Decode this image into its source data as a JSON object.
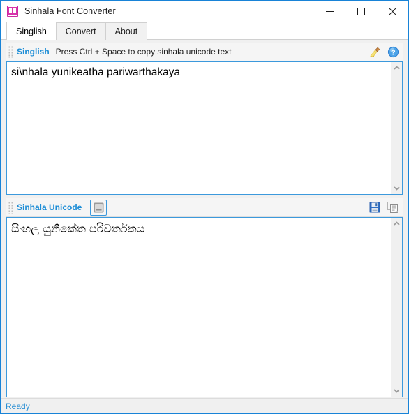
{
  "window": {
    "title": "Sinhala Font Converter",
    "icon": "app-icon",
    "controls": {
      "minimize": "minimize-icon",
      "maximize": "maximize-icon",
      "close": "close-icon"
    },
    "accent_color": "#1883d7"
  },
  "tabs": [
    {
      "label": "Singlish",
      "active": true
    },
    {
      "label": "Convert",
      "active": false
    },
    {
      "label": "About",
      "active": false
    }
  ],
  "input_panel": {
    "toolbar": {
      "label": "Singlish",
      "label_color": "#1d8dd6",
      "hint": "Press Ctrl + Space to copy sinhala unicode text",
      "buttons": [
        {
          "name": "clear-icon",
          "title": "Clear"
        },
        {
          "name": "help-icon",
          "title": "Help"
        }
      ]
    },
    "text": "si\\nhala yunikeatha pariwarthakaya",
    "placeholder": ""
  },
  "output_panel": {
    "toolbar": {
      "label": "Sinhala Unicode",
      "label_color": "#1d8dd6",
      "buttons": [
        {
          "name": "window-toggle-icon",
          "title": "Toggle window",
          "selected": true
        },
        {
          "name": "save-icon",
          "title": "Save"
        },
        {
          "name": "copy-icon",
          "title": "Copy"
        }
      ]
    },
    "text": "සිංහල යුනිකේත පරිවර්තකය",
    "placeholder": ""
  },
  "scrollbars": {
    "up_arrow": "chevron-up-icon",
    "down_arrow": "chevron-down-icon"
  },
  "statusbar": {
    "text": "Ready",
    "color": "#2a8fd4"
  }
}
